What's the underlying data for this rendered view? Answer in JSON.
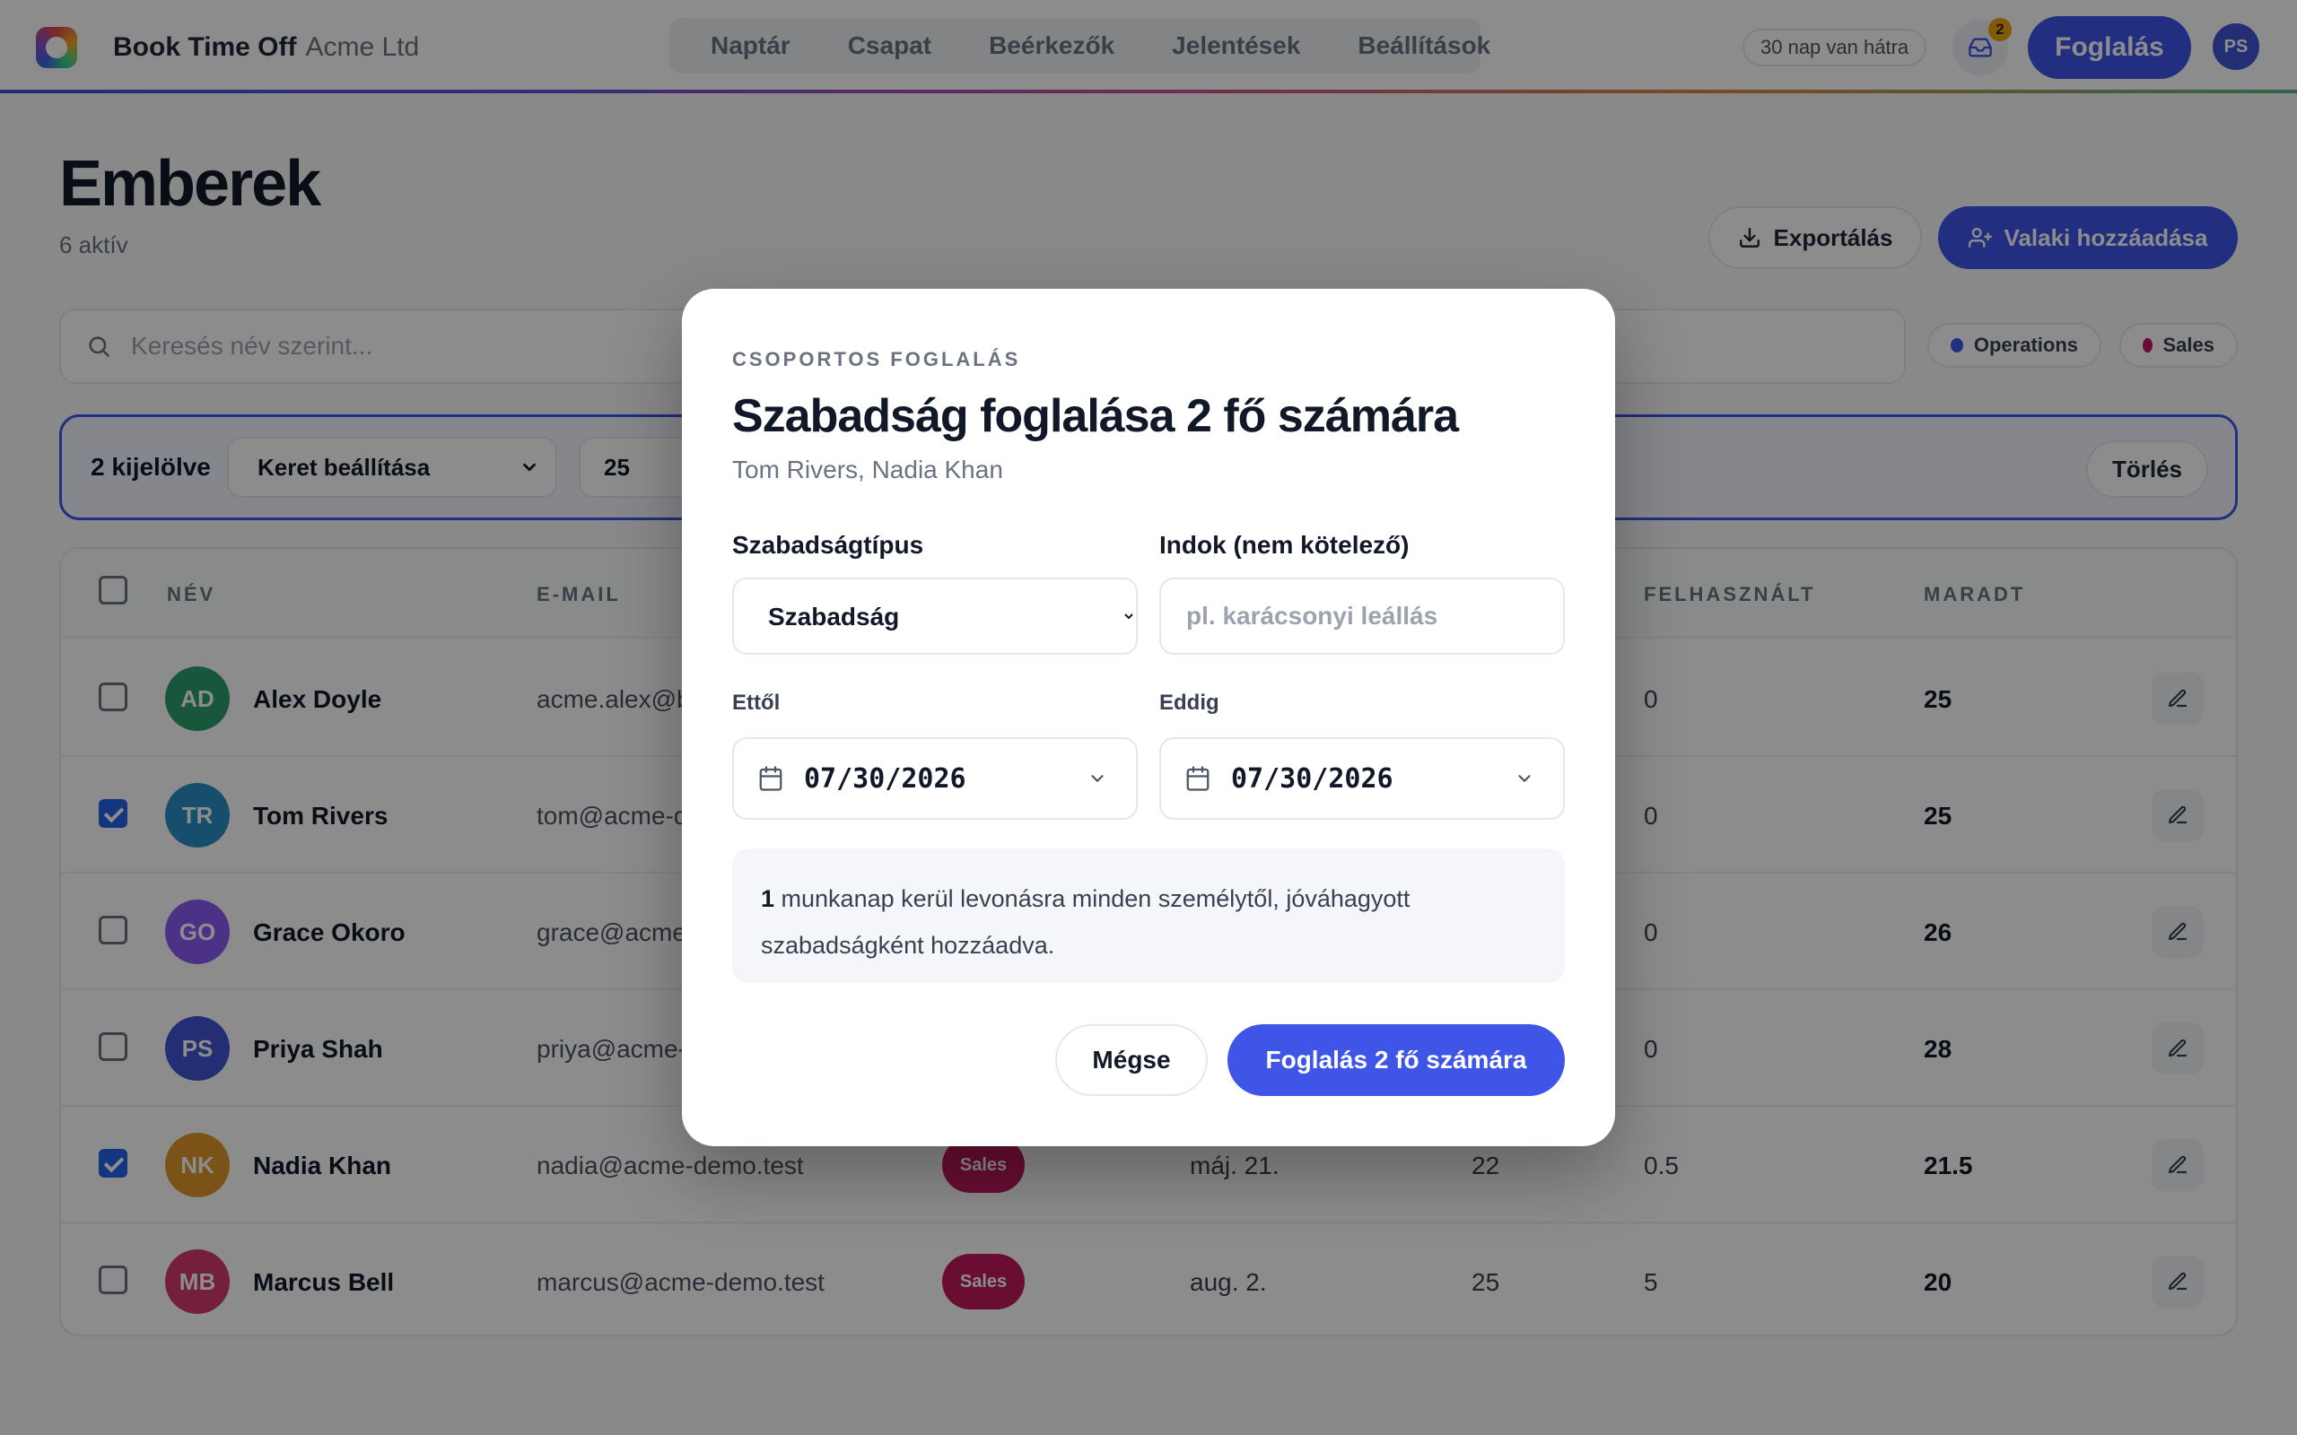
{
  "header": {
    "app_name": "Book Time Off",
    "org_name": "Acme Ltd",
    "nav": [
      {
        "label": "Naptár"
      },
      {
        "label": "Csapat"
      },
      {
        "label": "Beérkezők"
      },
      {
        "label": "Jelentések"
      },
      {
        "label": "Beállítások"
      }
    ],
    "trial_label": "30 nap van hátra",
    "inbox_badge": "2",
    "book_label": "Foglalás",
    "user_initials": "PS",
    "accent_color": "#3e55e8"
  },
  "page": {
    "title": "Emberek",
    "subtitle": "6 aktív",
    "export_label": "Exportálás",
    "add_label": "Valaki hozzáadása",
    "search_placeholder": "Keresés név szerint...",
    "filters": [
      {
        "label": "Operations",
        "color": "#3e55e8"
      },
      {
        "label": "Sales",
        "color": "#c2185b"
      }
    ]
  },
  "bulk": {
    "selected_label": "2 kijelölve",
    "action_select": "Keret beállítása",
    "allowance_value": "25",
    "clear_label": "Törlés"
  },
  "table": {
    "headers": {
      "name": "NÉV",
      "email": "E-MAIL",
      "used": "FELHASZNÁLT",
      "left": "MARADT"
    },
    "rows": [
      {
        "initials": "AD",
        "name": "Alex Doyle",
        "email": "acme.alex@b",
        "team": "",
        "start": "",
        "allowance": "",
        "used": "0",
        "left": "25",
        "checked": false,
        "color": "#2e9e6e"
      },
      {
        "initials": "TR",
        "name": "Tom Rivers",
        "email": "tom@acme-d",
        "team": "",
        "start": "",
        "allowance": "",
        "used": "0",
        "left": "25",
        "checked": true,
        "color": "#2a8fc8"
      },
      {
        "initials": "GO",
        "name": "Grace Okoro",
        "email": "grace@acme",
        "team": "",
        "start": "",
        "allowance": "",
        "used": "0",
        "left": "26",
        "checked": false,
        "color": "#8b5cf6"
      },
      {
        "initials": "PS",
        "name": "Priya Shah",
        "email": "priya@acme-",
        "team": "",
        "start": "",
        "allowance": "",
        "used": "0",
        "left": "28",
        "checked": false,
        "color": "#4355d6"
      },
      {
        "initials": "NK",
        "name": "Nadia Khan",
        "email": "nadia@acme-demo.test",
        "team": "Sales",
        "start": "máj. 21.",
        "allowance": "22",
        "used": "0.5",
        "left": "21.5",
        "checked": true,
        "color": "#e0982a"
      },
      {
        "initials": "MB",
        "name": "Marcus Bell",
        "email": "marcus@acme-demo.test",
        "team": "Sales",
        "start": "aug. 2.",
        "allowance": "25",
        "used": "5",
        "left": "20",
        "checked": false,
        "color": "#d63a72"
      }
    ],
    "team_color": "#c2185b"
  },
  "modal": {
    "eyebrow": "CSOPORTOS FOGLALÁS",
    "title": "Szabadság foglalása 2 fő számára",
    "people": "Tom Rivers, Nadia Khan",
    "type_label": "Szabadságtípus",
    "type_value": "Szabadság",
    "reason_label": "Indok (nem kötelező)",
    "reason_placeholder": "pl. karácsonyi leállás",
    "from_label": "Ettől",
    "from_value": "07/30/2026",
    "to_label": "Eddig",
    "to_value": "07/30/2026",
    "info_count": "1",
    "info_text": " munkanap kerül levonásra minden személytől, jóváhagyott szabadságként hozzáadva.",
    "cancel_label": "Mégse",
    "confirm_label": "Foglalás 2 fő számára"
  }
}
